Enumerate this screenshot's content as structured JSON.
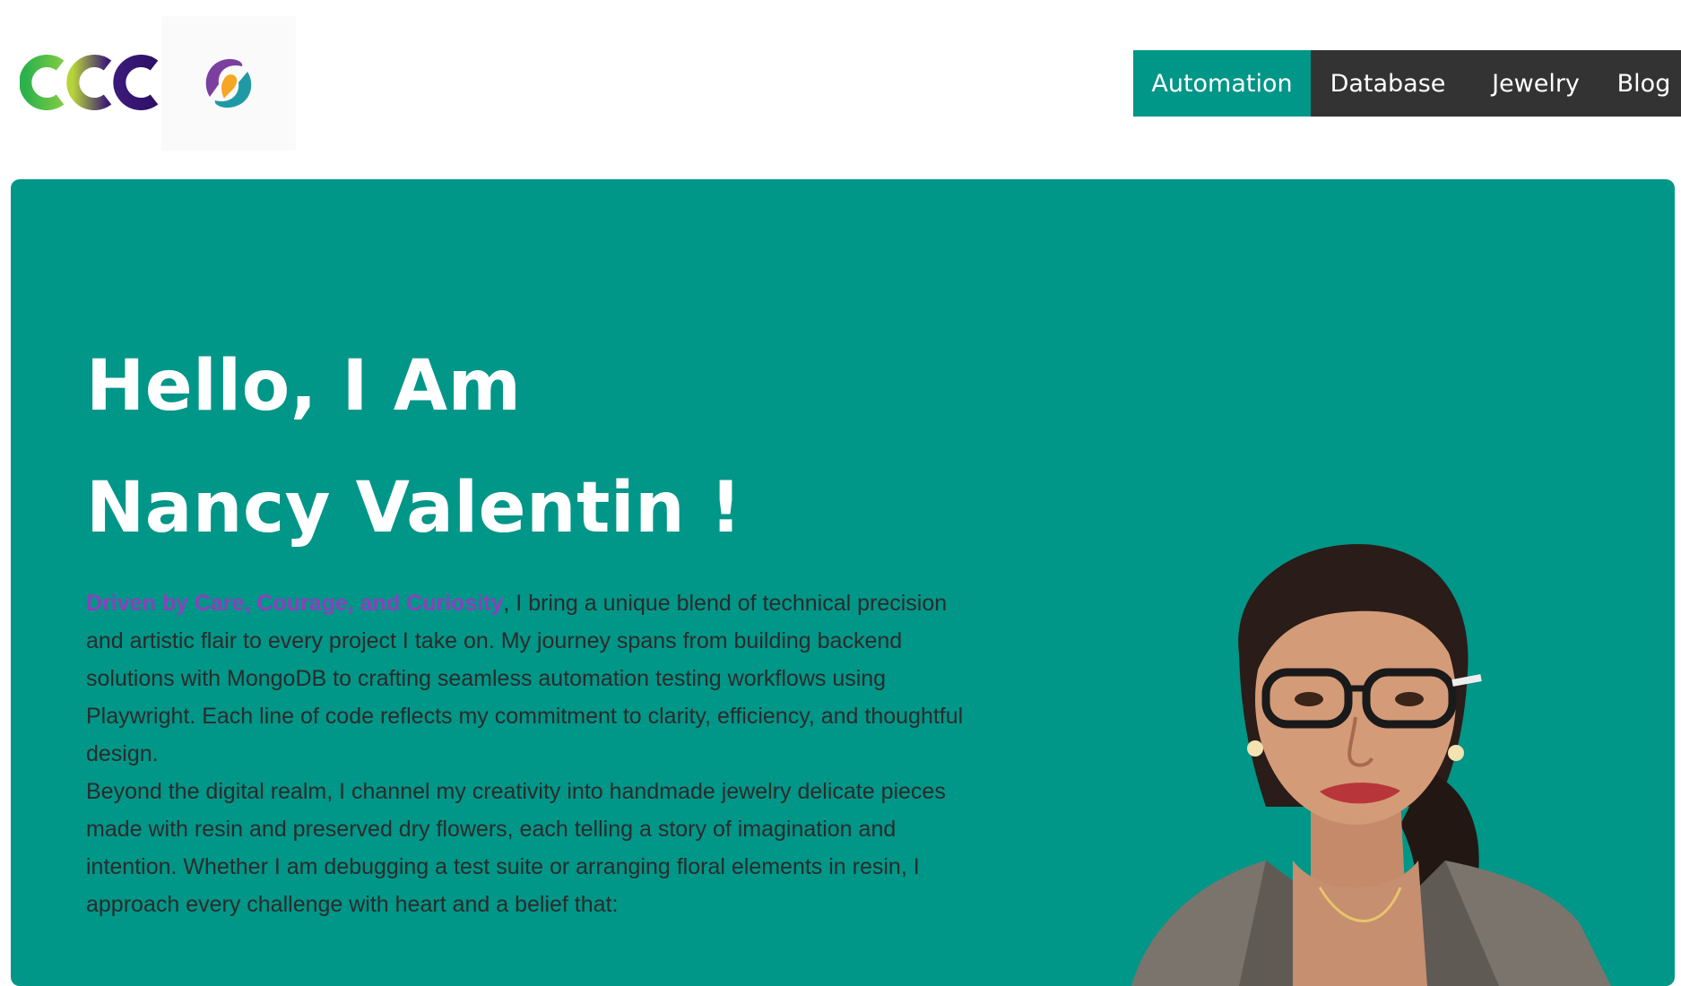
{
  "header": {
    "logo_text": "CCC",
    "nav": [
      {
        "label": "Automation",
        "active": true
      },
      {
        "label": "Database",
        "active": false
      },
      {
        "label": "Jewelry",
        "active": false
      },
      {
        "label": "Blog",
        "active": false
      }
    ]
  },
  "hero": {
    "title_line1": "Hello, I Am",
    "title_line2": "Nancy Valentin !",
    "highlight": "Driven by Care, Courage, and Curiosity",
    "paragraph1_rest": ", I bring a unique blend of technical precision and artistic flair to every project I take on. My journey spans from building backend solutions with MongoDB to crafting seamless automation testing workflows using Playwright. Each line of code reflects my commitment to clarity, efficiency, and thoughtful design.",
    "paragraph2": "Beyond the digital realm, I channel my creativity into handmade jewelry delicate pieces made with resin and preserved dry flowers, each telling a story of imagination and intention. Whether I am debugging a test suite or arranging floral elements in resin, I approach every challenge with heart and a belief that:"
  },
  "colors": {
    "accent": "#009688",
    "nav_dark": "#333333",
    "highlight": "#8e3fbd"
  },
  "icons": {
    "logo_badge": "heart-hands-icon",
    "portrait": "profile-photo"
  }
}
